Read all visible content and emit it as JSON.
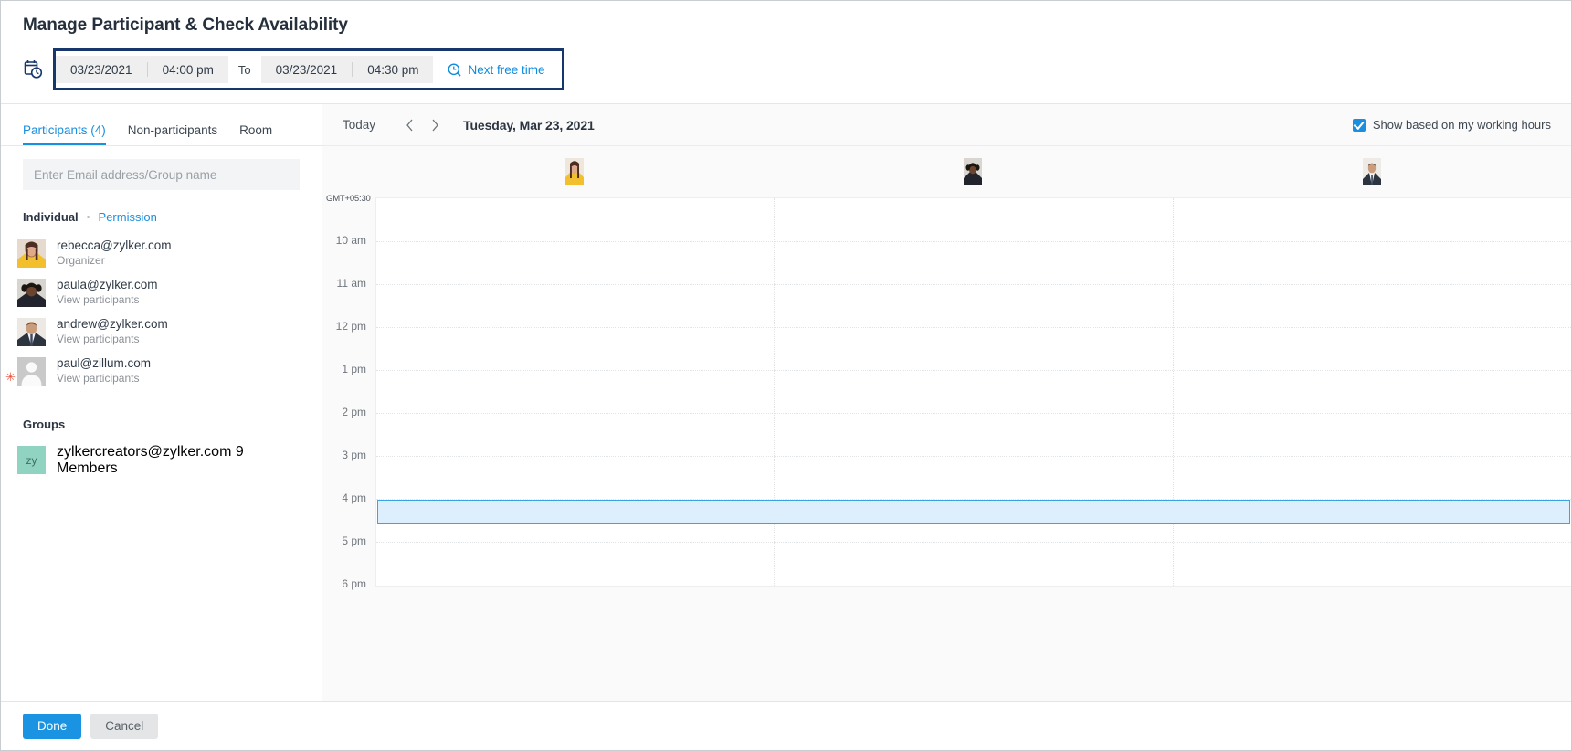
{
  "header": {
    "title": "Manage Participant & Check Availability",
    "calendar_clock_icon": "calendar-clock-icon",
    "timebar": {
      "start_date": "03/23/2021",
      "start_time": "04:00 pm",
      "to_label": "To",
      "end_date": "03/23/2021",
      "end_time": "04:30 pm",
      "next_free_time_label": "Next free time",
      "next_free_time_icon": "clock-search-icon",
      "outline_color": "#17366b",
      "link_color": "#0c8ce0"
    }
  },
  "sidebar": {
    "tabs": [
      {
        "label": "Participants (4)",
        "active": true
      },
      {
        "label": "Non-participants",
        "active": false
      },
      {
        "label": "Room",
        "active": false
      }
    ],
    "search": {
      "value": "",
      "placeholder": "Enter Email address/Group name"
    },
    "individual_section": {
      "label": "Individual",
      "separator": "•",
      "permission_label": "Permission"
    },
    "participants": [
      {
        "email": "rebecca@zylker.com",
        "role": "Organizer",
        "required": false,
        "avatar": "avatar-woman-1"
      },
      {
        "email": "paula@zylker.com",
        "role": "View participants",
        "required": false,
        "avatar": "avatar-woman-2"
      },
      {
        "email": "andrew@zylker.com",
        "role": "View participants",
        "required": false,
        "avatar": "avatar-man-1"
      },
      {
        "email": "paul@zillum.com",
        "role": "View participants",
        "required": true,
        "avatar": "avatar-placeholder"
      }
    ],
    "required_marker": "✳",
    "groups_section": {
      "label": "Groups"
    },
    "groups": [
      {
        "name": "zylkercreators@zylker.com",
        "members": "9 Members",
        "initials": "zy",
        "color": "#8fd3c0"
      }
    ]
  },
  "calendar": {
    "today_label": "Today",
    "prev_icon": "chevron-left-icon",
    "next_icon": "chevron-right-icon",
    "current_date": "Tuesday, Mar 23, 2021",
    "working_hours_toggle": {
      "label": "Show based on my working hours",
      "checked": true,
      "accent": "#1a8fe0"
    },
    "timezone_label": "GMT+05:30",
    "columns": [
      {
        "avatar": "avatar-woman-1"
      },
      {
        "avatar": "avatar-woman-2"
      },
      {
        "avatar": "avatar-man-1"
      }
    ],
    "time_labels": [
      "10 am",
      "11 am",
      "12 pm",
      "1 pm",
      "2 pm",
      "3 pm",
      "4 pm",
      "5 pm",
      "6 pm"
    ],
    "selection": {
      "start": "4 pm",
      "end": "4:30 pm",
      "fill": "#ddeffc",
      "border": "#3ba2e5"
    }
  },
  "footer": {
    "done_label": "Done",
    "cancel_label": "Cancel",
    "primary_color": "#1a94e2"
  }
}
